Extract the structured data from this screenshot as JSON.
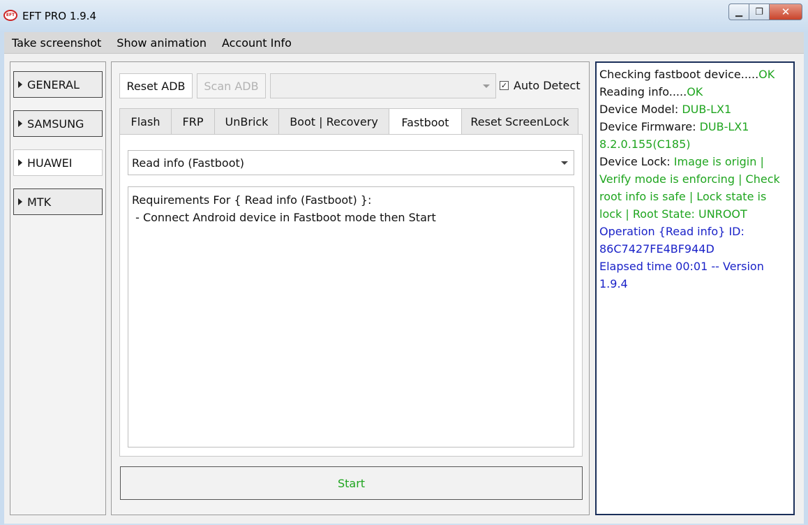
{
  "window": {
    "title": "EFT PRO 1.9.4",
    "icon_text": "EFT",
    "minimize": "▁",
    "maximize": "❐",
    "close": "✕"
  },
  "menu": {
    "items": [
      "Take screenshot",
      "Show animation",
      "Account Info"
    ]
  },
  "brands": [
    {
      "label": "GENERAL",
      "active": false
    },
    {
      "label": "SAMSUNG",
      "active": false
    },
    {
      "label": "HUAWEI",
      "active": true
    },
    {
      "label": "MTK",
      "active": false
    }
  ],
  "toolbar": {
    "reset_adb": "Reset ADB",
    "scan_adb": "Scan ADB",
    "device_combo_value": "",
    "auto_detect_label": "Auto Detect",
    "auto_detect_checked": true
  },
  "tabs": [
    {
      "label": "Flash"
    },
    {
      "label": "FRP"
    },
    {
      "label": "UnBrick"
    },
    {
      "label": "Boot | Recovery"
    },
    {
      "label": "Fastboot",
      "active": true
    },
    {
      "label": "Reset ScreenLock"
    }
  ],
  "operation": {
    "selected": "Read info (Fastboot)",
    "requirements_title": "Requirements For { Read info (Fastboot) }:",
    "requirements_line": " - Connect Android device in Fastboot mode then Start"
  },
  "start_label": "Start",
  "log": {
    "checking_label": "Checking fastboot device.....",
    "checking_status": "OK",
    "reading_label": "Reading info.....",
    "reading_status": "OK",
    "model_label": "Device Model: ",
    "model_value": "DUB-LX1",
    "firmware_label": "Device Firmware: ",
    "firmware_value": "DUB-LX1 8.2.0.155(C185)",
    "lock_label": "Device Lock: ",
    "lock_value": "Image is origin | Verify mode is enforcing | Check root info is safe | Lock state is lock | Root State: UNROOT",
    "operation_line": "Operation {Read info} ID: 86C7427FE4BF944D",
    "elapsed_line": "Elapsed time 00:01 -- Version 1.9.4"
  },
  "colors": {
    "ok_green": "#1fa51f",
    "info_blue": "#1a22c8",
    "log_border": "#1a2f5a"
  }
}
